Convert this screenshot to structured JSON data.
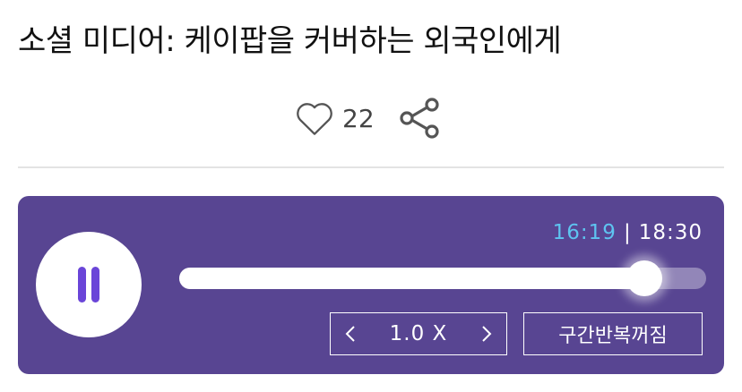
{
  "article": {
    "title": "소셜 미디어: 케이팝을 커버하는 외국인에게"
  },
  "actions": {
    "like_count": "22",
    "like_icon": "heart-outline-icon",
    "share_icon": "share-icon"
  },
  "player": {
    "state": "playing",
    "pause_icon": "pause-icon",
    "current_time": "16:19",
    "separator": "|",
    "total_time": "18:30",
    "progress_fraction": 0.882,
    "speed": {
      "value": "1.0 X",
      "prev_icon": "chevron-left-icon",
      "next_icon": "chevron-right-icon"
    },
    "repeat_label": "구간반복꺼짐"
  },
  "colors": {
    "player_background": "#584592",
    "current_time": "#5ec4f0",
    "pause_icon": "#6a45d8"
  }
}
